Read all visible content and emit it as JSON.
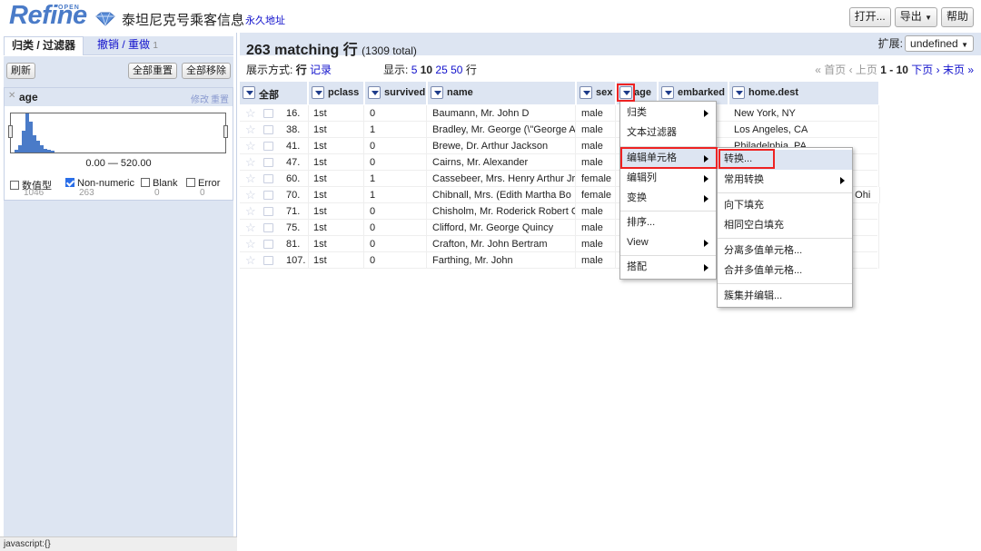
{
  "header": {
    "logo_text": "Refine",
    "logo_badge": "OPEN",
    "project_title": "泰坦尼克号乘客信息",
    "permalink": "永久地址",
    "buttons": {
      "open": "打开...",
      "export": "导出",
      "help": "帮助"
    }
  },
  "left": {
    "tabs": {
      "facets": "归类 / 过滤器",
      "undo": "撤销 / 重做",
      "undo_count": "1"
    },
    "refresh": "刷新",
    "reset_all": "全部重置",
    "remove_all": "全部移除",
    "facet": {
      "name": "age",
      "edit": "修改",
      "reset": "重置",
      "range": "0.00 — 520.00",
      "histogram_levels": [
        0.06,
        0.18,
        0.55,
        1.0,
        0.8,
        0.45,
        0.3,
        0.18,
        0.1,
        0.06,
        0.04
      ],
      "choices": [
        {
          "label": "数值型",
          "count": "1046",
          "checked": false
        },
        {
          "label": "Non-numeric",
          "count": "263",
          "checked": true
        },
        {
          "label": "Blank",
          "count": "0",
          "checked": false
        },
        {
          "label": "Error",
          "count": "0",
          "checked": false
        }
      ]
    },
    "status": "javascript:{}"
  },
  "main": {
    "summary": {
      "count": "263 matching 行",
      "total": "(1309 total)"
    },
    "extend_label": "扩展:",
    "extend_value": "undefined",
    "view_mode_label": "展示方式:",
    "view_rows": "行",
    "view_records": "记录",
    "show_label": "显示:",
    "page_sizes": [
      "5",
      "10",
      "25",
      "50"
    ],
    "show_unit": "行",
    "pager": {
      "first": "« 首页",
      "prev": "‹ 上页",
      "range": "1 - 10",
      "next": "下页 ›",
      "last": "末页 »"
    }
  },
  "columns": [
    "全部",
    "pclass",
    "survived",
    "name",
    "sex",
    "age",
    "embarked",
    "home.dest"
  ],
  "rows": [
    {
      "idx": "16.",
      "pclass": "1st",
      "survived": "0",
      "name": "Baumann, Mr. John D",
      "sex": "male",
      "home": "New York, NY"
    },
    {
      "idx": "38.",
      "pclass": "1st",
      "survived": "1",
      "name": "Bradley, Mr. George (\\\"George Ar",
      "sex": "male",
      "home": "Los Angeles, CA"
    },
    {
      "idx": "41.",
      "pclass": "1st",
      "survived": "0",
      "name": "Brewe, Dr. Arthur Jackson",
      "sex": "male",
      "home": "Philadelphia, PA"
    },
    {
      "idx": "47.",
      "pclass": "1st",
      "survived": "0",
      "name": "Cairns, Mr. Alexander",
      "sex": "male",
      "home": ""
    },
    {
      "idx": "60.",
      "pclass": "1st",
      "survived": "1",
      "name": "Cassebeer, Mrs. Henry Arthur Jr",
      "sex": "female",
      "home": ""
    },
    {
      "idx": "70.",
      "pclass": "1st",
      "survived": "1",
      "name": "Chibnall, Mrs. (Edith Martha Bo",
      "sex": "female",
      "home": "d Ohi"
    },
    {
      "idx": "71.",
      "pclass": "1st",
      "survived": "0",
      "name": "Chisholm, Mr. Roderick Robert C",
      "sex": "male",
      "home": ""
    },
    {
      "idx": "75.",
      "pclass": "1st",
      "survived": "0",
      "name": "Clifford, Mr. George Quincy",
      "sex": "male",
      "home": ""
    },
    {
      "idx": "81.",
      "pclass": "1st",
      "survived": "0",
      "name": "Crafton, Mr. John Bertram",
      "sex": "male",
      "home": ""
    },
    {
      "idx": "107.",
      "pclass": "1st",
      "survived": "0",
      "name": "Farthing, Mr. John",
      "sex": "male",
      "home": ""
    }
  ],
  "column_menu": [
    "归类",
    "文本过滤器",
    "编辑单元格",
    "编辑列",
    "变换",
    "排序...",
    "View",
    "搭配"
  ],
  "submenu": [
    "转换...",
    "常用转换",
    "向下填充",
    "相同空白填充",
    "分离多值单元格...",
    "合并多值单元格...",
    "簇集并编辑..."
  ]
}
